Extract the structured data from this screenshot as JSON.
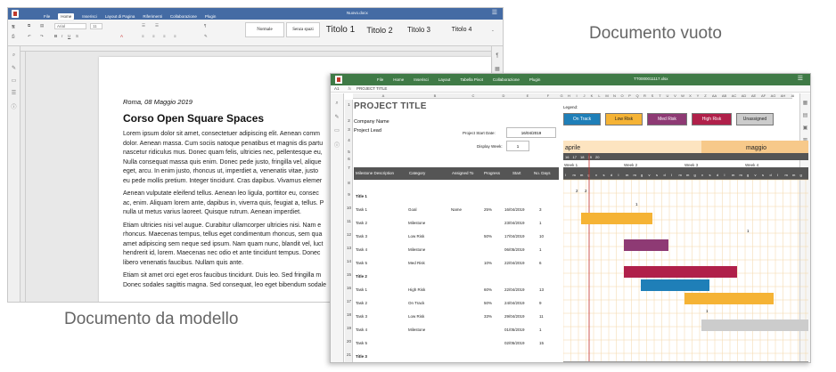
{
  "labels": {
    "empty_doc": "Documento vuoto",
    "template_doc": "Documento da modello"
  },
  "writer": {
    "title": "Nuovo.docx",
    "menu": [
      "File",
      "Home",
      "Inserisci",
      "Layout di Pagina",
      "Riferimenti",
      "Collaborazione",
      "Plugin"
    ],
    "active_menu": "Home",
    "font_name": "Arial",
    "font_size": "11",
    "styles": [
      "Normale",
      "Senza spazi",
      "Titolo 1",
      "Titolo 2",
      "Titolo 3",
      "Titolo 4"
    ],
    "doc_date": "Roma, 08 Maggio 2019",
    "doc_heading": "Corso Open Square Spaces",
    "paragraphs": [
      [
        "Lorem ipsum dolor sit amet, consectetuer adipiscing elit. Aenean comm",
        "dolor. Aenean massa. Cum sociis natoque penatibus et magnis dis partu",
        "nascetur ridiculus mus. Donec quam felis, ultricies nec, pellentesque eu,",
        "Nulla consequat massa quis enim. Donec pede justo, fringilla vel, alique",
        "eget, arcu. In enim justo, rhoncus ut, imperdiet a, venenatis vitae, justo",
        "eu pede mollis pretium. Integer tincidunt. Cras dapibus. Vivamus elemer"
      ],
      [
        "Aenean vulputate eleifend tellus. Aenean leo ligula, porttitor eu, consec",
        "ac, enim. Aliquam lorem ante, dapibus in, viverra quis, feugiat a, tellus. P",
        "nulla ut metus varius laoreet. Quisque rutrum. Aenean imperdiet."
      ],
      [
        "Etiam ultricies nisi vel augue. Curabitur ullamcorper ultricies nisi. Nam e",
        "rhoncus. Maecenas tempus, tellus eget condimentum rhoncus, sem qua",
        "amet adipiscing sem neque sed ipsum. Nam quam nunc, blandit vel, luct",
        "hendrerit id, lorem. Maecenas nec odio et ante tincidunt tempus. Donec",
        "libero venenatis faucibus. Nullam quis ante."
      ],
      [
        "Etiam sit amet orci eget eros faucibus tincidunt. Duis leo. Sed fringilla m",
        "Donec sodales sagittis magna. Sed consequat, leo eget bibendum sodale"
      ]
    ]
  },
  "sheet": {
    "title": "TT0000011117.xlsx",
    "menu": [
      "File",
      "Home",
      "Inserisci",
      "Layout",
      "Tabella Pivot",
      "Collaborazione",
      "Plugin"
    ],
    "cell_ref": "A1",
    "formula": "PROJECT TITLE",
    "project_title": "PROJECT TITLE",
    "company": "Company Name",
    "lead": "Project Lead",
    "start_label": "Project Start Date:",
    "start_value": "16/04/2019",
    "week_label": "Display Week:",
    "week_value": "1",
    "legend_title": "Legend:",
    "legend": [
      {
        "label": "On Track",
        "color": "#1f7fb8"
      },
      {
        "label": "Low Risk",
        "color": "#f5b335"
      },
      {
        "label": "Med Risk",
        "color": "#8e3a74"
      },
      {
        "label": "High Risk",
        "color": "#b0204a"
      },
      {
        "label": "Unassigned",
        "color": "#cccccc"
      }
    ],
    "months": [
      "aprile",
      "maggio"
    ],
    "weeks": [
      "Week 1",
      "Week 2",
      "Week 3",
      "Week 4"
    ],
    "day_numbers": [
      "16",
      "17",
      "18",
      "19",
      "20"
    ],
    "headers": [
      "Milestone Description",
      "Category",
      "Assigned To",
      "Progress",
      "Start",
      "No. Days"
    ],
    "rows": [
      {
        "n": "9",
        "d": "Title 1",
        "c": "",
        "a": "",
        "p": "",
        "s": "",
        "nd": "",
        "bold": true
      },
      {
        "n": "10",
        "d": "Task 1",
        "c": "Goal",
        "a": "Name",
        "p": "25%",
        "s": "16/04/2019",
        "nd": "3"
      },
      {
        "n": "11",
        "d": "Task 2",
        "c": "Milestone",
        "a": "",
        "p": "",
        "s": "23/04/2019",
        "nd": "1"
      },
      {
        "n": "12",
        "d": "Task 3",
        "c": "Low Risk",
        "a": "",
        "p": "50%",
        "s": "17/04/2019",
        "nd": "10"
      },
      {
        "n": "13",
        "d": "Task 4",
        "c": "Milestone",
        "a": "",
        "p": "",
        "s": "06/05/2019",
        "nd": "1"
      },
      {
        "n": "14",
        "d": "Task 5",
        "c": "Med Risk",
        "a": "",
        "p": "10%",
        "s": "22/04/2019",
        "nd": "6"
      },
      {
        "n": "15",
        "d": "Title 2",
        "c": "",
        "a": "",
        "p": "",
        "s": "",
        "nd": "",
        "bold": true
      },
      {
        "n": "16",
        "d": "Task 1",
        "c": "High Risk",
        "a": "",
        "p": "60%",
        "s": "22/04/2019",
        "nd": "13"
      },
      {
        "n": "17",
        "d": "Task 2",
        "c": "On Track",
        "a": "",
        "p": "50%",
        "s": "24/04/2019",
        "nd": "9"
      },
      {
        "n": "18",
        "d": "Task 3",
        "c": "Low Risk",
        "a": "",
        "p": "33%",
        "s": "29/04/2019",
        "nd": "11"
      },
      {
        "n": "19",
        "d": "Task 4",
        "c": "Milestone",
        "a": "",
        "p": "",
        "s": "01/05/2019",
        "nd": "1"
      },
      {
        "n": "20",
        "d": "Task 5",
        "c": "",
        "a": "",
        "p": "",
        "s": "02/05/2019",
        "nd": "15"
      },
      {
        "n": "21",
        "d": "Title 3",
        "c": "",
        "a": "",
        "p": "",
        "s": "",
        "nd": "",
        "bold": true
      }
    ],
    "marks": [
      "2",
      "2",
      "1",
      "1",
      "1"
    ]
  }
}
